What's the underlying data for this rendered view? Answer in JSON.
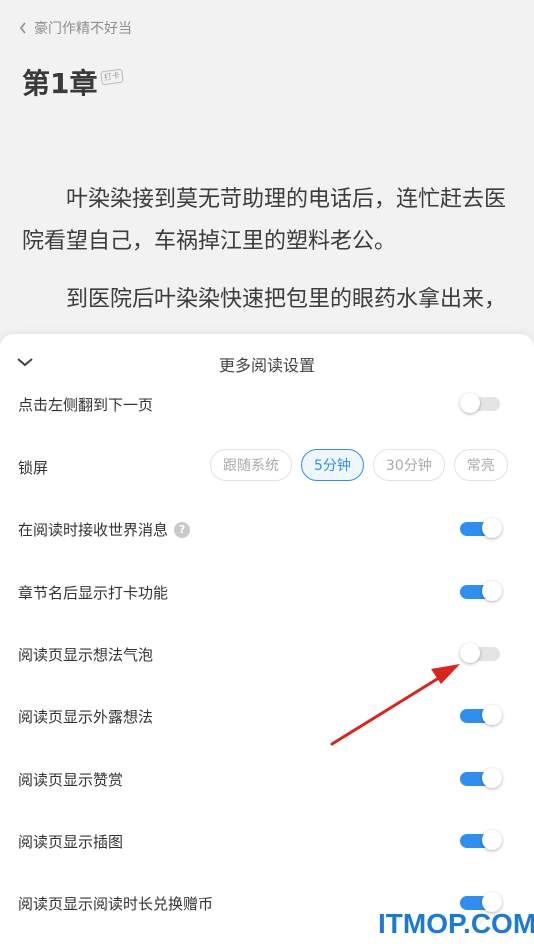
{
  "header": {
    "back_label": "豪门作精不好当",
    "chapter_title": "第1章",
    "checkin_badge": "打卡"
  },
  "content": {
    "paragraphs": [
      "叶染染接到莫无苛助理的电话后，连忙赶去医院看望自己，车祸掉江里的塑料老公。",
      "到医院后叶染染快速把包里的眼药水拿出来，"
    ]
  },
  "settings_panel": {
    "title": "更多阅读设置",
    "rows": [
      {
        "label": "点击左侧翻到下一页",
        "on": false
      },
      {
        "label": "锁屏"
      },
      {
        "label": "在阅读时接收世界消息",
        "on": true
      },
      {
        "label": "章节名后显示打卡功能",
        "on": true
      },
      {
        "label": "阅读页显示想法气泡",
        "on": false
      },
      {
        "label": "阅读页显示外露想法",
        "on": true
      },
      {
        "label": "阅读页显示赞赏",
        "on": true
      },
      {
        "label": "阅读页显示插图",
        "on": true
      },
      {
        "label": "阅读页显示阅读时长兑换赠币",
        "on": true
      }
    ],
    "lock_options": [
      "跟随系统",
      "5分钟",
      "30分钟",
      "常亮"
    ],
    "lock_selected": "5分钟",
    "help_glyph": "?"
  },
  "colors": {
    "accent": "#2f8ff0",
    "arrow": "#d9241f"
  },
  "watermark": "ITMOP.COM"
}
